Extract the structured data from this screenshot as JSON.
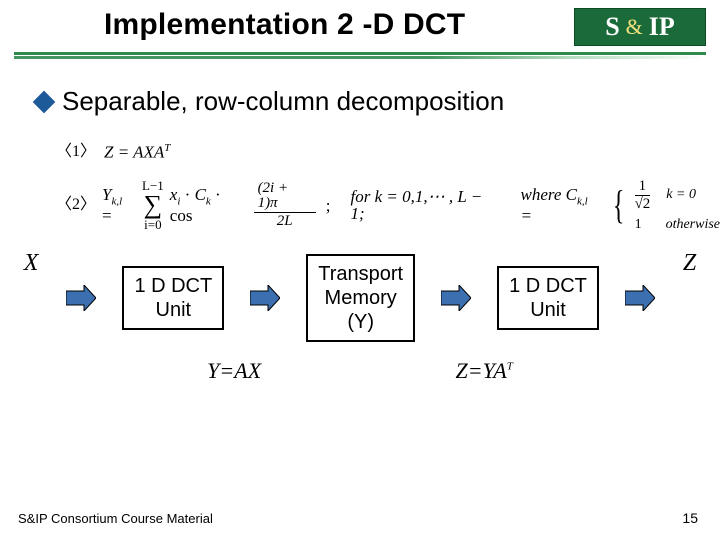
{
  "title": "Implementation 2 -D DCT",
  "logo": {
    "s": "S",
    "amp": "&",
    "ip": "IP"
  },
  "bullet": "Separable, row-column decomposition",
  "eq1_tag": "〈1〉",
  "eq1": "Z = AXA",
  "eq1_sup": "T",
  "eq2_tag": "〈2〉",
  "eq2_lhs": "Y",
  "eq2_lhs_sub": "k,l",
  "sigma_top": "L−1",
  "sigma_bot": "i=0",
  "eq2_term": "x",
  "eq2_term_sub": "i",
  "eq2_ck": "C",
  "eq2_ck_sub": "k",
  "eq2_cos": "cos",
  "frac_top": "(2i + 1)π",
  "frac_bot": "2L",
  "eq2_cond": "for   k = 0,1,⋯ , L − 1;",
  "eq2_where": "where   C",
  "eq2_where_sub": "k,l",
  "eq2_eq": " =",
  "case1_val_top": "1",
  "case1_val_bot": "√2",
  "case1_cond": "k = 0",
  "case2_val": "1",
  "case2_cond": "otherwise",
  "diagram": {
    "X": "X",
    "box1_l1": "1 D DCT",
    "box1_l2": "Unit",
    "box2_l1": "Transport",
    "box2_l2": "Memory",
    "box2_l3": "(Y)",
    "box3_l1": "1 D DCT",
    "box3_l2": "Unit",
    "Z": "Z",
    "under1": "Y=AX",
    "under2": "Z=YA",
    "under2_sup": "T"
  },
  "footer": "S&IP Consortium Course Material",
  "page": "15"
}
